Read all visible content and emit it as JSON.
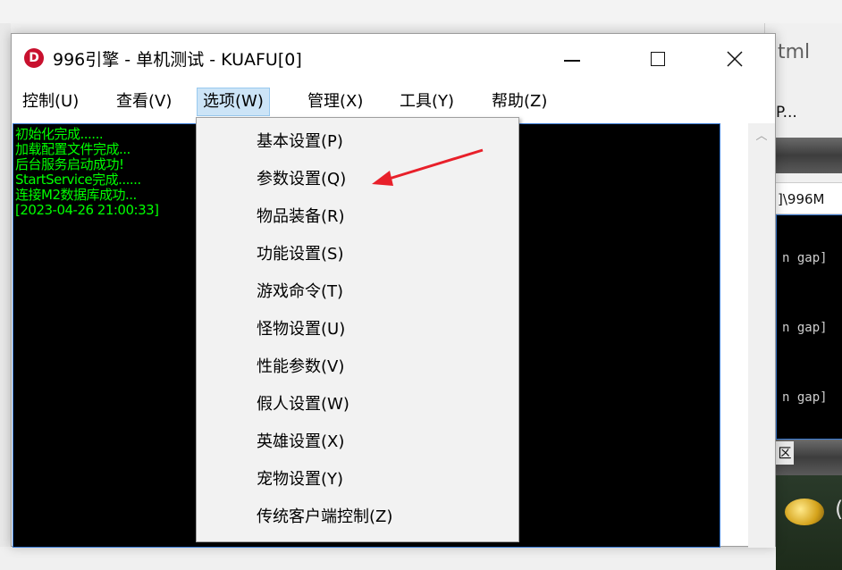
{
  "background": {
    "tab_text": "tml",
    "p_text": "P...",
    "path_text": "]\\996M",
    "console_lines": [
      "n gap]",
      "n gap]",
      "n gap]"
    ],
    "qu_char": "区",
    "paren": "("
  },
  "window": {
    "logo_letter": "D",
    "title": "996引擎 - 单机测试 - KUAFU[0]",
    "minimize": "—",
    "maximize": "",
    "close": "✕"
  },
  "menubar": [
    "控制(U)",
    "查看(V)",
    "选项(W)",
    "管理(X)",
    "工具(Y)",
    "帮助(Z)"
  ],
  "console_log": [
    "初始化完成......",
    "加载配置文件完成...",
    "后台服务启动成功!",
    "StartService完成......",
    "连接M2数据库成功...",
    "[2023-04-26 21:00:33]"
  ],
  "dropdown": {
    "items": [
      "基本设置(P)",
      "参数设置(Q)",
      "物品装备(R)",
      "功能设置(S)",
      "游戏命令(T)",
      "怪物设置(U)",
      "性能参数(V)",
      "假人设置(W)",
      "英雄设置(X)",
      "宠物设置(Y)",
      "传统客户端控制(Z)"
    ]
  },
  "colors": {
    "console_text": "#00ff00",
    "menu_highlight": "#cce4f7",
    "annotation_arrow": "#e8202a",
    "logo": "#c8102e"
  }
}
